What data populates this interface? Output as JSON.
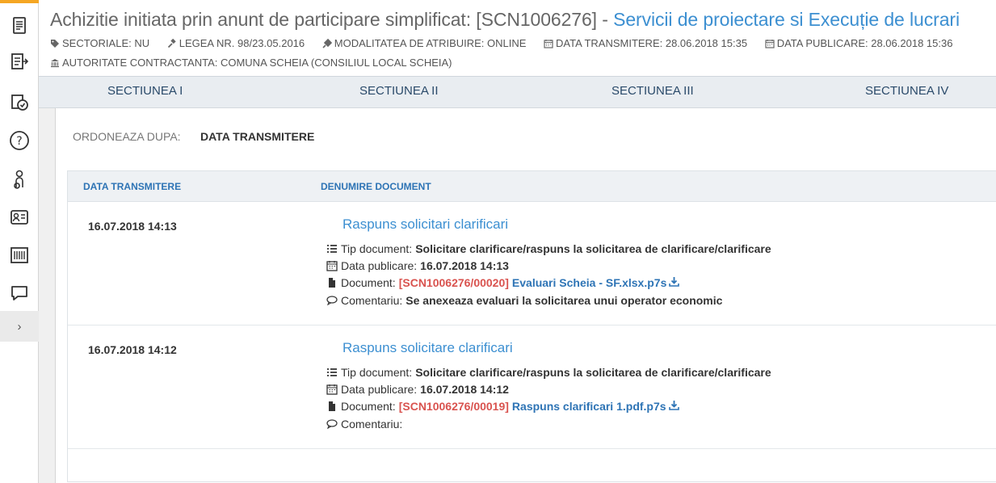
{
  "header": {
    "title_prefix": "Achizitie initiata prin anunt de participare simplificat: [SCN1006276] - ",
    "title_link": "Servicii de proiectare si Execuție de lucrari",
    "meta": {
      "sectoriale": "SECTORIALE: NU",
      "legea": "LEGEA NR. 98/23.05.2016",
      "modalitatea": "MODALITATEA DE ATRIBUIRE: ONLINE",
      "data_transmitere": "DATA TRANSMITERE: 28.06.2018 15:35",
      "data_publicare": "DATA PUBLICARE: 28.06.2018 15:36",
      "autoritate": "AUTORITATE CONTRACTANTA: COMUNA SCHEIA (CONSILIUL LOCAL SCHEIA)"
    }
  },
  "tabs": [
    "SECTIUNEA I",
    "SECTIUNEA II",
    "SECTIUNEA III",
    "SECTIUNEA IV"
  ],
  "sort": {
    "label": "ORDONEAZA DUPA:",
    "value": "DATA TRANSMITERE"
  },
  "table": {
    "headers": {
      "date": "DATA TRANSMITERE",
      "name": "DENUMIRE DOCUMENT"
    },
    "labels": {
      "tip": "Tip document:",
      "publicare": "Data publicare:",
      "document": "Document:",
      "comentariu": "Comentariu:"
    },
    "rows": [
      {
        "date": "16.07.2018 14:13",
        "title": "Raspuns solicitari clarificari",
        "tip": "Solicitare clarificare/raspuns la solicitarea de clarificare/clarificare",
        "publicare": "16.07.2018 14:13",
        "doc_id": "[SCN1006276/00020]",
        "doc_name": "Evaluari Scheia - SF.xlsx.p7s",
        "comentariu": "Se anexeaza evaluari la solicitarea unui operator economic"
      },
      {
        "date": "16.07.2018 14:12",
        "title": "Raspuns solicitare clarificari",
        "tip": "Solicitare clarificare/raspuns la solicitarea de clarificare/clarificare",
        "publicare": "16.07.2018 14:12",
        "doc_id": "[SCN1006276/00019]",
        "doc_name": "Raspuns clarificari 1.pdf.p7s",
        "comentariu": ""
      }
    ]
  },
  "colors": {
    "accent": "#f5a623",
    "link": "#3c8fd1",
    "doc_id": "#d9534f"
  }
}
